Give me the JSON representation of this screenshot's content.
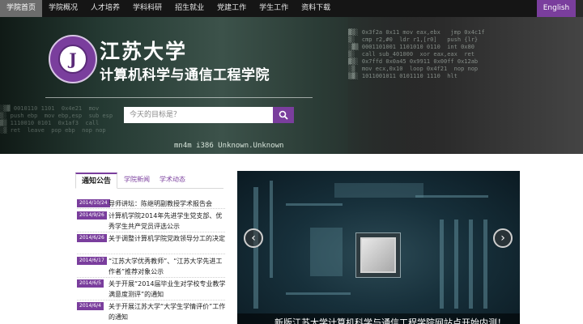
{
  "nav": {
    "items": [
      "学院首页",
      "学院概况",
      "人才培养",
      "学科科研",
      "招生就业",
      "党建工作",
      "学生工作",
      "资料下载"
    ],
    "active_index": 0,
    "english_label": "English"
  },
  "banner": {
    "university_name": "江苏大学",
    "college_name": "计算机科学与通信工程学院",
    "logo_char": "J",
    "code_text": "mn4m i386 Unknown.Unknown"
  },
  "search": {
    "placeholder": "今天的目标是？"
  },
  "notices": {
    "tabs": [
      "通知公告",
      "学院新闻",
      "学术动态"
    ],
    "active_tab": 0,
    "items": [
      {
        "date": "2014/10/24",
        "title": "导师讲坛：陈继明副教授学术报告会"
      },
      {
        "date": "2014/9/26",
        "title": "计算机学院2014年先进学生党支部、优秀学生共产党员评选公示"
      },
      {
        "date": "2014/6/26",
        "title": "关于调整计算机学院党政领导分工的决定"
      },
      {
        "date": "2014/6/17",
        "title": "“江苏大学优秀教师”、“江苏大学先进工作者”推荐对象公示"
      },
      {
        "date": "2014/6/5",
        "title": "关于开展“2014届毕业生对学校专业教学满意度测评”的通知"
      },
      {
        "date": "2014/6/4",
        "title": "关于开展江苏大学“大学生学情评价”工作的通知"
      }
    ]
  },
  "slideshow": {
    "caption": "新版江苏大学计算机科学与通信工程学院网站点开始内测！"
  },
  "colors": {
    "accent": "#7a3e9d",
    "nav_bg": "#151515"
  }
}
